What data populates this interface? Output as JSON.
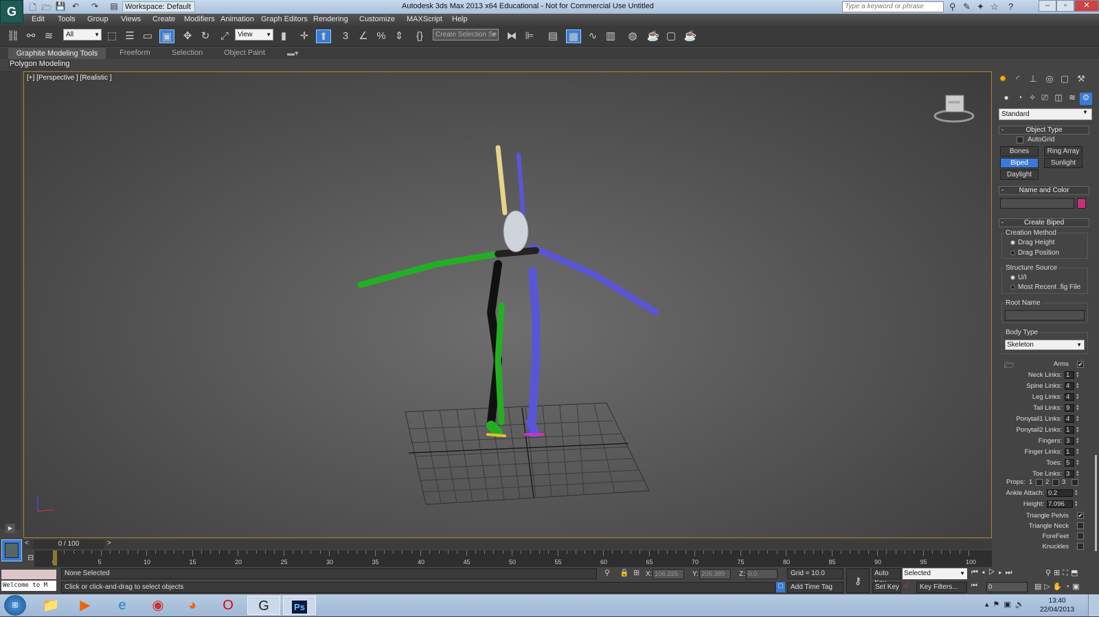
{
  "titlebar": {
    "workspace": "Workspace: Default",
    "title": "Autodesk 3ds Max  2013 x64   Educational - Not for Commercial Use   Untitled",
    "search_placeholder": "Type a keyword or phrase"
  },
  "menu": [
    "Edit",
    "Tools",
    "Group",
    "Views",
    "Create",
    "Modifiers",
    "Animation",
    "Graph Editors",
    "Rendering",
    "Customize",
    "MAXScript",
    "Help"
  ],
  "toolbar": {
    "selection_filter": "All",
    "ref_coord": "View",
    "named_selection": "Create Selection Se",
    "snap_3": "3"
  },
  "ribbon": {
    "tabs": [
      "Graphite Modeling Tools",
      "Freeform",
      "Selection",
      "Object Paint"
    ],
    "panel": "Polygon Modeling"
  },
  "viewport": {
    "label": "[+] [Perspective ] [Realistic ]",
    "viewcube_label": "FRONT"
  },
  "command_panel": {
    "category": "Standard",
    "object_type": {
      "title": "Object Type",
      "autogrid": "AutoGrid",
      "buttons": [
        "Bones",
        "Ring Array",
        "Biped",
        "Sunlight",
        "Daylight"
      ],
      "active": "Biped"
    },
    "name_color": {
      "title": "Name and Color",
      "name_value": "",
      "color": "#c8307a"
    },
    "create_biped": {
      "title": "Create Biped",
      "creation_method": {
        "title": "Creation Method",
        "options": [
          "Drag Height",
          "Drag Position"
        ],
        "selected": "Drag Height"
      },
      "structure_source": {
        "title": "Structure Source",
        "options": [
          "U/I",
          "Most Recent .fig File"
        ],
        "selected": "U/I"
      },
      "root_name": {
        "title": "Root Name",
        "value": ""
      },
      "body_type": {
        "title": "Body Type",
        "value": "Skeleton"
      },
      "arms": {
        "label": "Arms",
        "checked": true
      },
      "spinners": [
        {
          "label": "Neck Links:",
          "value": "1"
        },
        {
          "label": "Spine Links:",
          "value": "4"
        },
        {
          "label": "Leg Links:",
          "value": "4"
        },
        {
          "label": "Tail Links:",
          "value": "9"
        },
        {
          "label": "Ponytail1 Links:",
          "value": "4"
        },
        {
          "label": "Ponytail2 Links:",
          "value": "1"
        },
        {
          "label": "Fingers:",
          "value": "3"
        },
        {
          "label": "Finger Links:",
          "value": "1"
        },
        {
          "label": "Toes:",
          "value": "5"
        },
        {
          "label": "Toe Links:",
          "value": "3"
        }
      ],
      "props": {
        "label": "Props:",
        "items": [
          "1",
          "2",
          "3"
        ]
      },
      "ankle_attach": {
        "label": "Ankle Attach:",
        "value": "0.2"
      },
      "height": {
        "label": "Height:",
        "value": "7.096"
      },
      "checks": [
        {
          "label": "Triangle Pelvis",
          "checked": true
        },
        {
          "label": "Triangle Neck",
          "checked": false
        },
        {
          "label": "ForeFeet",
          "checked": false
        },
        {
          "label": "Knuckles",
          "checked": false
        }
      ]
    }
  },
  "timeline": {
    "frame": "0 / 100",
    "ticks": [
      "0",
      "5",
      "10",
      "15",
      "20",
      "25",
      "30",
      "35",
      "40",
      "45",
      "50",
      "55",
      "60",
      "65",
      "70",
      "75",
      "80",
      "85",
      "90",
      "95",
      "100"
    ]
  },
  "status": {
    "maxscript": "Welcome to M",
    "selection": "None Selected",
    "prompt": "Click or click-and-drag to select objects",
    "x_label": "X:",
    "x": "106.225",
    "y_label": "Y:",
    "y": "205.389",
    "z_label": "Z:",
    "z": "0.0",
    "grid": "Grid = 10.0",
    "add_time_tag": "Add Time Tag",
    "auto_key": "Auto Key",
    "set_key": "Set Key",
    "key_mode": "Selected",
    "key_filters": "Key Filters...",
    "current_frame": "0"
  },
  "taskbar": {
    "time": "13:40",
    "date": "22/04/2013",
    "ps_label": "Ps"
  }
}
